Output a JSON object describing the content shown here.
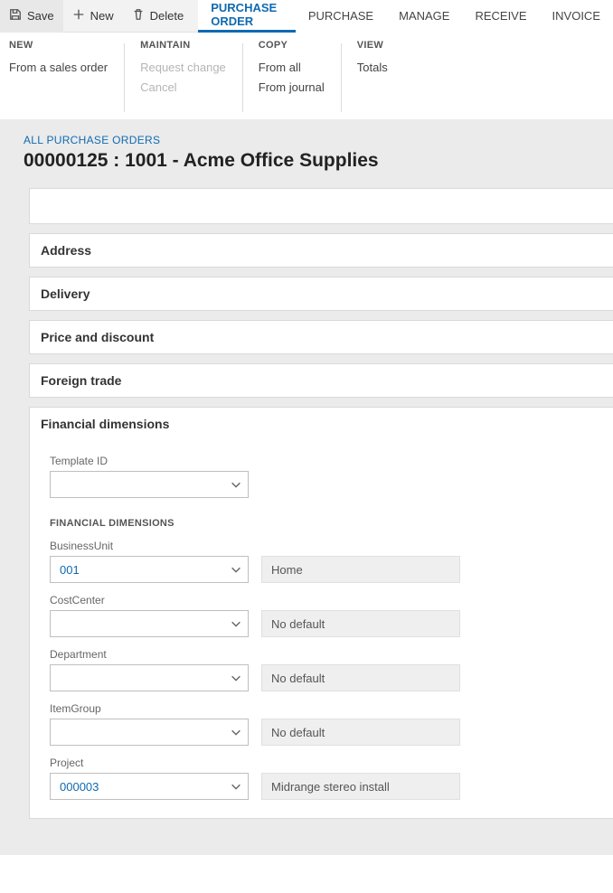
{
  "toolbar": {
    "save": "Save",
    "new": "New",
    "delete": "Delete"
  },
  "tabs": {
    "purchase_order": "PURCHASE ORDER",
    "purchase": "PURCHASE",
    "manage": "MANAGE",
    "receive": "RECEIVE",
    "invoice": "INVOICE"
  },
  "ribbon": {
    "new": {
      "title": "NEW",
      "from_sales_order": "From a sales order"
    },
    "maintain": {
      "title": "MAINTAIN",
      "request_change": "Request change",
      "cancel": "Cancel"
    },
    "copy": {
      "title": "COPY",
      "from_all": "From all",
      "from_journal": "From journal"
    },
    "view": {
      "title": "VIEW",
      "totals": "Totals"
    }
  },
  "breadcrumb": "ALL PURCHASE ORDERS",
  "page_title": "00000125 : 1001 - Acme Office Supplies",
  "sections": {
    "address": "Address",
    "delivery": "Delivery",
    "price_discount": "Price and discount",
    "foreign_trade": "Foreign trade",
    "financial_dimensions": "Financial dimensions"
  },
  "fd": {
    "template_id_label": "Template ID",
    "template_id_value": "",
    "subheading": "FINANCIAL DIMENSIONS",
    "business_unit": {
      "label": "BusinessUnit",
      "value": "001",
      "desc": "Home"
    },
    "cost_center": {
      "label": "CostCenter",
      "value": "",
      "desc": "No default"
    },
    "department": {
      "label": "Department",
      "value": "",
      "desc": "No default"
    },
    "item_group": {
      "label": "ItemGroup",
      "value": "",
      "desc": "No default"
    },
    "project": {
      "label": "Project",
      "value": "000003",
      "desc": "Midrange stereo install"
    }
  }
}
